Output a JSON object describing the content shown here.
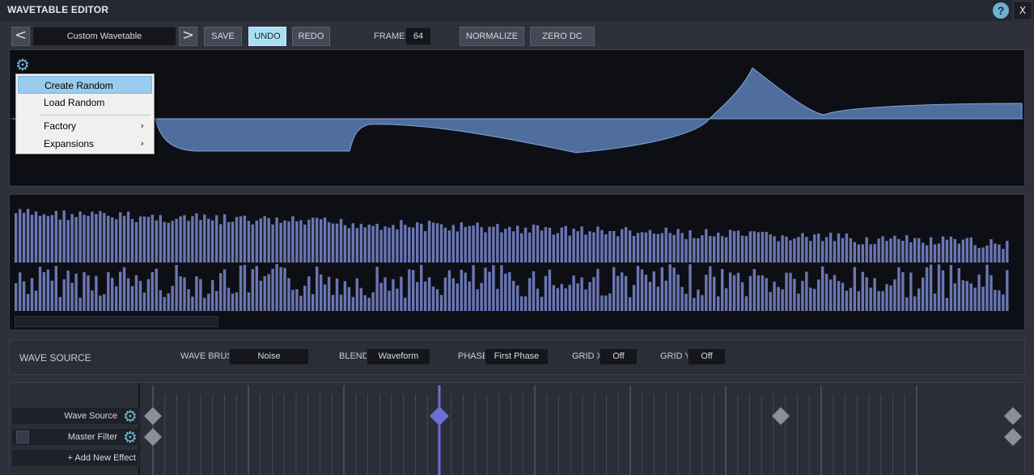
{
  "window": {
    "title": "WAVETABLE EDITOR",
    "help_label": "?",
    "close_label": "X"
  },
  "toolbar": {
    "prev_label": "<",
    "next_label": ">",
    "preset_name": "Custom Wavetable",
    "save_label": "SAVE",
    "undo_label": "UNDO",
    "redo_label": "REDO",
    "frames_label": "FRAMES:",
    "frames_value": "64",
    "normalize_label": "NORMALIZE",
    "zero_dc_label": "ZERO DC"
  },
  "context_menu": {
    "items": [
      {
        "label": "Create Random",
        "highlighted": true,
        "submenu": false
      },
      {
        "label": "Load Random",
        "highlighted": false,
        "submenu": false
      },
      {
        "label": "Factory",
        "highlighted": false,
        "submenu": true
      },
      {
        "label": "Expansions",
        "highlighted": false,
        "submenu": true
      }
    ],
    "submenu_arrow": "›"
  },
  "wave_source_panel": {
    "title": "WAVE SOURCE",
    "wave_brush_label": "WAVE BRUSH:",
    "wave_brush_value": "Noise",
    "blend_label": "BLEND:",
    "blend_value": "Waveform",
    "phase_label": "PHASE:",
    "phase_value": "First Phase",
    "grid_x_label": "GRID X:",
    "grid_x_value": "Off",
    "grid_y_label": "GRID Y:",
    "grid_y_value": "Off"
  },
  "effects": {
    "rows": [
      {
        "label": "Wave Source"
      },
      {
        "label": "Master Filter"
      }
    ],
    "add_label": "+ Add New Effect"
  },
  "colors": {
    "waveform_fill": "#4f6e9e",
    "waveform_line": "#7fa6d6",
    "bar_color": "#6a76b3",
    "accent": "#6fb2cf",
    "playhead": "#6e6fd6",
    "menu_highlight": "#99cbef"
  }
}
